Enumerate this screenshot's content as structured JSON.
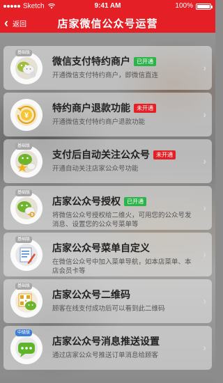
{
  "status_bar": {
    "carrier": "Sketch",
    "time": "9:41 AM",
    "battery": "100%"
  },
  "nav": {
    "back_label": "返回",
    "title": "店家微信公众号运营"
  },
  "colors": {
    "header_red": "#e41f26",
    "tag_on": "#2cb34a",
    "tag_off": "#e41f26",
    "badge_gray": "#a6a6a6",
    "badge_blue": "#3d7fd6"
  },
  "items": [
    {
      "icon": "wechat-pay-icon",
      "badge": "基础版",
      "title": "微信支付特约商户",
      "status": "已开通",
      "status_state": "on",
      "desc": "开通微信支付特约商户，即微信直连"
    },
    {
      "icon": "refund-yen-icon",
      "badge": "",
      "title": "特约商户退款功能",
      "status": "未开通",
      "status_state": "off",
      "desc": "开通微信支付特约商户退款功能"
    },
    {
      "icon": "auto-follow-star-icon",
      "badge": "基础版",
      "title": "支付后自动关注公众号",
      "status": "未开通",
      "status_state": "off",
      "desc": "开通自动关注店家公众号功能"
    },
    {
      "icon": "wechat-key-icon",
      "badge": "基础版",
      "title": "店家公众号授权",
      "status": "已开通",
      "status_state": "on",
      "desc": "将微信公众号授权给二维火，可用您的公众号发消息、设置您的公众号菜单等"
    },
    {
      "icon": "menu-edit-icon",
      "badge": "基础版",
      "title": "店家公众号菜单自定义",
      "status": "",
      "status_state": "",
      "desc": "在微信公众号中加入菜单导航，如本店菜单、本店会员卡等"
    },
    {
      "icon": "qrcode-wechat-icon",
      "badge": "基础版",
      "title": "店家公众号二维码",
      "status": "",
      "status_state": "",
      "desc": "顾客在线支付成功后可以看到此二维码"
    },
    {
      "icon": "message-push-icon",
      "badge": "中级版",
      "title": "店家公众号消息推送设置",
      "status": "",
      "status_state": "",
      "desc": "通过店家公众号推送订单消息给顾客"
    }
  ]
}
